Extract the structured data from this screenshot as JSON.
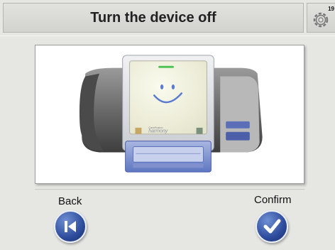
{
  "header": {
    "title": "Turn the device off",
    "settings_badge": "19",
    "settings_icon": "gear-icon"
  },
  "illustration": {
    "device_brand": "harmony",
    "device_brand_small": "CareFusion"
  },
  "footer": {
    "back_label": "Back",
    "confirm_label": "Confirm",
    "back_icon": "skip-back-icon",
    "confirm_icon": "checkmark-icon",
    "button_color": "#2e4c9c"
  }
}
